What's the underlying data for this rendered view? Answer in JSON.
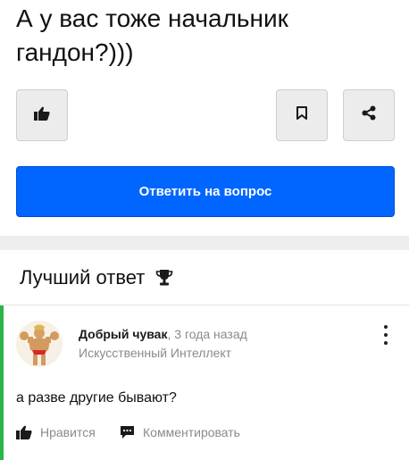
{
  "question": {
    "title": "А у вас тоже начальник гандон?)))"
  },
  "toolbar": {
    "like_icon": "thumbs-up-icon",
    "bookmark_icon": "bookmark-icon",
    "share_icon": "share-icon"
  },
  "answer_button": {
    "label": "Ответить на вопрос",
    "color": "#0066ff"
  },
  "best_answer": {
    "heading": "Лучший ответ",
    "heading_icon": "trophy-icon",
    "accent_color": "#2ab54a",
    "author": {
      "name": "Добрый чувак",
      "time_ago": ", 3 года назад",
      "rank": "Искусственный Интеллект",
      "avatar": "bodybuilder-avatar"
    },
    "text": "а разве другие бывают?",
    "actions": {
      "like_label": "Нравится",
      "comment_label": "Комментировать"
    }
  }
}
